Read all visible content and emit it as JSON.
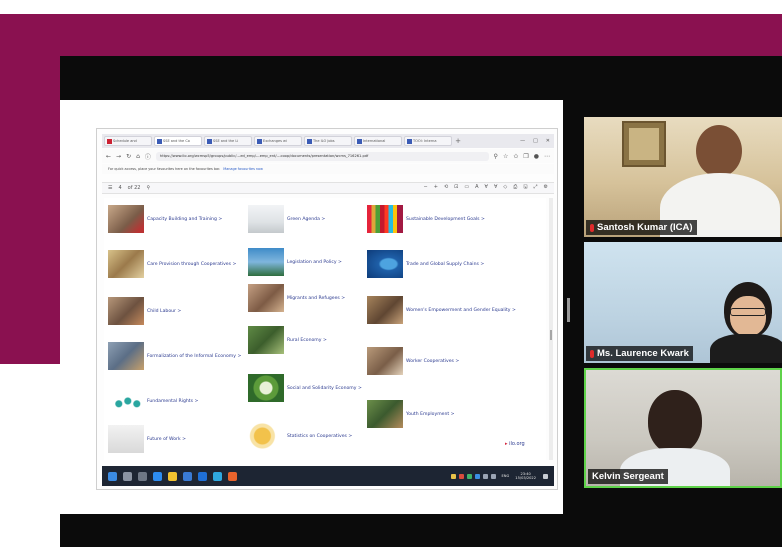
{
  "browser": {
    "tabs": [
      {
        "label": "Schedule and",
        "active": false
      },
      {
        "label": "SSE and the Co",
        "active": true
      },
      {
        "label": "SSE and the Li",
        "active": false
      },
      {
        "label": "Exchanges wi",
        "active": false
      },
      {
        "label": "The ILO Jobs",
        "active": false
      },
      {
        "label": "International",
        "active": false
      },
      {
        "label": "TOOI: Interna",
        "active": false
      }
    ],
    "new_tab": "+",
    "url": "https://www.ilo.org/wcmsp5/groups/public/---ed_emp/---emp_ent/---coop/documents/presentation/wcms_716261.pdf",
    "favorites_text": "For quick access, place your favourites here on the favourites bar.",
    "favorites_link": "Manage favourites now",
    "page_count": "of 22"
  },
  "pdf": {
    "items": [
      {
        "label": "Capacity Building and Training >"
      },
      {
        "label": "Care Provision through Cooperatives >"
      },
      {
        "label": "Child Labour >"
      },
      {
        "label": "Formalization of the Informal Economy >"
      },
      {
        "label": "Fundamental Rights >"
      },
      {
        "label": "Future of Work >"
      },
      {
        "label": "Green Agenda >"
      },
      {
        "label": "Legislation and Policy >"
      },
      {
        "label": "Migrants and Refugees >"
      },
      {
        "label": "Rural Economy >"
      },
      {
        "label": "Social and Solidarity Economy >"
      },
      {
        "label": "Statistics on Cooperatives >"
      },
      {
        "label": "Sustainable Development Goals >"
      },
      {
        "label": "Trade and Global Supply Chains >"
      },
      {
        "label": "Women's Empowerment and Gender Equality >"
      },
      {
        "label": "Worker Cooperatives >"
      },
      {
        "label": "Youth Employment >"
      }
    ],
    "site_mark": "ilo.org"
  },
  "taskbar": {
    "time": "23:40",
    "date": "15/03/2022",
    "lang": "ENG"
  },
  "participants": [
    {
      "name": "Santosh Kumar (ICA)",
      "muted": true
    },
    {
      "name": "Ms. Laurence Kwark",
      "muted": true
    },
    {
      "name": "Kelvin Sergeant",
      "muted": false
    }
  ],
  "colors": {
    "brand_maroon": "#8a1150",
    "link_blue": "#2b3a8f",
    "active_speaker": "#5fd24a"
  }
}
